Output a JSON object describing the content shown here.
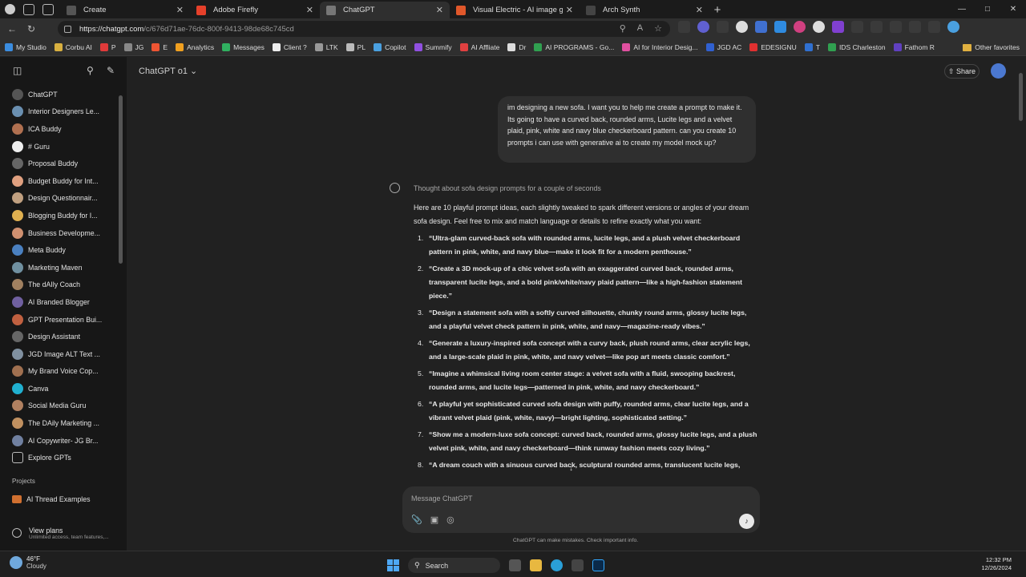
{
  "browser": {
    "tabs": [
      {
        "label": "Create",
        "color": "#555555"
      },
      {
        "label": "Adobe Firefly",
        "color": "#e5402a"
      },
      {
        "label": "ChatGPT",
        "color": "#777777",
        "active": true
      },
      {
        "label": "Visual Electric - AI image generat...",
        "color": "#e0572a"
      },
      {
        "label": "Arch Synth",
        "color": "#444444"
      }
    ],
    "url_host": "https://chatgpt.com",
    "url_path": "/c/676d71ae-76dc-800f-9413-98de68c745cd",
    "bookmarks": [
      {
        "label": "My Studio",
        "color": "#3b8de0"
      },
      {
        "label": "Corbu AI",
        "color": "#d8b040"
      },
      {
        "label": "P",
        "color": "#e03a3a"
      },
      {
        "label": "JG",
        "color": "#888888"
      },
      {
        "label": "E",
        "color": "#ee5533"
      },
      {
        "label": "Analytics",
        "color": "#f0a020"
      },
      {
        "label": "Messages",
        "color": "#30b060"
      },
      {
        "label": "Client ?",
        "color": "#eeeeee"
      },
      {
        "label": "LTK",
        "color": "#999999"
      },
      {
        "label": "PL",
        "color": "#bbbbbb"
      },
      {
        "label": "Copilot",
        "color": "#4aa0e0"
      },
      {
        "label": "Summify",
        "color": "#9050e0"
      },
      {
        "label": "AI Affliate",
        "color": "#e04040"
      },
      {
        "label": "Dr",
        "color": "#dddddd"
      },
      {
        "label": "AI PROGRAMS - Go...",
        "color": "#30a050"
      },
      {
        "label": "AI for Interior Desig...",
        "color": "#e050a0"
      },
      {
        "label": "JGD AC",
        "color": "#3060d0"
      },
      {
        "label": "EDESIGNU",
        "color": "#e03030"
      },
      {
        "label": "T",
        "color": "#3070d0"
      },
      {
        "label": "IDS Charleston",
        "color": "#30a050"
      },
      {
        "label": "Fathom R",
        "color": "#6040c0"
      }
    ],
    "other_favorites": "Other favorites"
  },
  "sidebar": {
    "items": [
      {
        "label": "ChatGPT",
        "color": "#555555"
      },
      {
        "label": "Interior Designers Le...",
        "color": "#6a8fb0"
      },
      {
        "label": "ICA Buddy",
        "color": "#b07050"
      },
      {
        "label": "# Guru",
        "color": "#eeeeee"
      },
      {
        "label": "Proposal Buddy",
        "color": "#666666"
      },
      {
        "label": "Budget Buddy for Int...",
        "color": "#e0a080"
      },
      {
        "label": "Design Questionnair...",
        "color": "#c0a080"
      },
      {
        "label": "Blogging Buddy for I...",
        "color": "#e0b050"
      },
      {
        "label": "Business Developme...",
        "color": "#d09070"
      },
      {
        "label": "Meta Buddy",
        "color": "#4a80c0"
      },
      {
        "label": "Marketing Maven",
        "color": "#7090a0"
      },
      {
        "label": "The dAIly Coach",
        "color": "#a08060"
      },
      {
        "label": "AI Branded Blogger",
        "color": "#7060a0"
      },
      {
        "label": "GPT Presentation Bui...",
        "color": "#c06040"
      },
      {
        "label": "Design Assistant",
        "color": "#666666"
      },
      {
        "label": "JGD Image ALT Text ...",
        "color": "#8090a0"
      },
      {
        "label": "My Brand Voice Cop...",
        "color": "#a07050"
      },
      {
        "label": "Canva",
        "color": "#20b0d0"
      },
      {
        "label": "Social Media Guru",
        "color": "#b08060"
      },
      {
        "label": "The DAily Marketing ...",
        "color": "#c09060"
      },
      {
        "label": "AI Copywriter- JG Br...",
        "color": "#7080a0"
      },
      {
        "label": "Explore GPTs",
        "color": "#171717"
      }
    ],
    "projects_heading": "Projects",
    "project_item": "AI Thread Examples",
    "view_plans": "View plans",
    "view_plans_sub": "Unlimited access, team features,..."
  },
  "main": {
    "model": "ChatGPT o1",
    "share": "Share",
    "user_message": "im designing a new sofa. I want you to help me create a prompt to make it. Its going to have a curved back, rounded arms, Lucite legs and a velvet plaid, pink, white and navy blue checkerboard pattern. can you create 10 prompts i can use with generative ai to create my model mock up?",
    "thought": "Thought about sofa design prompts for a couple of seconds",
    "intro": "Here are 10 playful prompt ideas, each slightly tweaked to spark different versions or angles of your dream sofa design. Feel free to mix and match language or details to refine exactly what you want:",
    "prompts": [
      {
        "n": "1.",
        "text": "“Ultra-glam curved-back sofa with rounded arms, lucite legs, and a plush velvet checkerboard pattern in pink, white, and navy blue—make it look fit for a modern penthouse.”"
      },
      {
        "n": "2.",
        "text": "“Create a 3D mock-up of a chic velvet sofa with an exaggerated curved back, rounded arms, transparent lucite legs, and a bold pink/white/navy plaid pattern—like a high-fashion statement piece.”"
      },
      {
        "n": "3.",
        "text": "“Design a statement sofa with a softly curved silhouette, chunky round arms, glossy lucite legs, and a playful velvet check pattern in pink, white, and navy—magazine-ready vibes.”"
      },
      {
        "n": "4.",
        "text": "“Generate a luxury-inspired sofa concept with a curvy back, plush round arms, clear acrylic legs, and a large-scale plaid in pink, white, and navy velvet—like pop art meets classic comfort.”"
      },
      {
        "n": "5.",
        "text": "“Imagine a whimsical living room center stage: a velvet sofa with a fluid, swooping backrest, rounded arms, and lucite legs—patterned in pink, white, and navy checkerboard.”"
      },
      {
        "n": "6.",
        "text": "“A playful yet sophisticated curved sofa design with puffy, rounded arms, clear lucite legs, and a vibrant velvet plaid (pink, white, navy)—bright lighting, sophisticated setting.”"
      },
      {
        "n": "7.",
        "text": "“Show me a modern-luxe sofa concept: curved back, rounded arms, glossy lucite legs, and a plush velvet pink, white, and navy checkerboard—think runway fashion meets cozy living.”"
      },
      {
        "n": "8.",
        "text": "“A dream couch with a sinuous curved back, sculptural rounded arms, translucent lucite legs,"
      }
    ],
    "composer_placeholder": "Message ChatGPT",
    "disclaimer": "ChatGPT can make mistakes. Check important info."
  },
  "taskbar": {
    "temp": "46°F",
    "weather": "Cloudy",
    "search": "Search",
    "time": "12:32 PM",
    "date": "12/26/2024"
  }
}
